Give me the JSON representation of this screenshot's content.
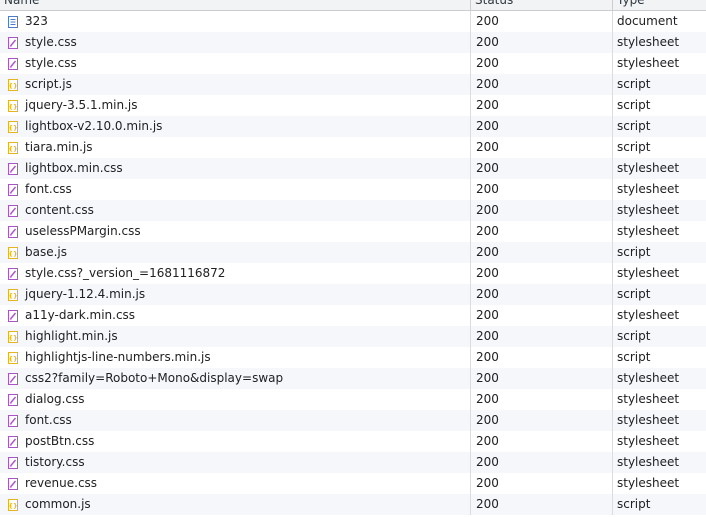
{
  "header": {
    "name_label": "Name",
    "status_label": "Status",
    "type_label": "Type"
  },
  "rows": [
    {
      "name": "323",
      "status": "200",
      "type": "document",
      "icon": "document-icon"
    },
    {
      "name": "style.css",
      "status": "200",
      "type": "stylesheet",
      "icon": "stylesheet-icon"
    },
    {
      "name": "style.css",
      "status": "200",
      "type": "stylesheet",
      "icon": "stylesheet-icon"
    },
    {
      "name": "script.js",
      "status": "200",
      "type": "script",
      "icon": "script-icon"
    },
    {
      "name": "jquery-3.5.1.min.js",
      "status": "200",
      "type": "script",
      "icon": "script-icon"
    },
    {
      "name": "lightbox-v2.10.0.min.js",
      "status": "200",
      "type": "script",
      "icon": "script-icon"
    },
    {
      "name": "tiara.min.js",
      "status": "200",
      "type": "script",
      "icon": "script-icon"
    },
    {
      "name": "lightbox.min.css",
      "status": "200",
      "type": "stylesheet",
      "icon": "stylesheet-icon"
    },
    {
      "name": "font.css",
      "status": "200",
      "type": "stylesheet",
      "icon": "stylesheet-icon"
    },
    {
      "name": "content.css",
      "status": "200",
      "type": "stylesheet",
      "icon": "stylesheet-icon"
    },
    {
      "name": "uselessPMargin.css",
      "status": "200",
      "type": "stylesheet",
      "icon": "stylesheet-icon"
    },
    {
      "name": "base.js",
      "status": "200",
      "type": "script",
      "icon": "script-icon"
    },
    {
      "name": "style.css?_version_=1681116872",
      "status": "200",
      "type": "stylesheet",
      "icon": "stylesheet-icon"
    },
    {
      "name": "jquery-1.12.4.min.js",
      "status": "200",
      "type": "script",
      "icon": "script-icon"
    },
    {
      "name": "a11y-dark.min.css",
      "status": "200",
      "type": "stylesheet",
      "icon": "stylesheet-icon"
    },
    {
      "name": "highlight.min.js",
      "status": "200",
      "type": "script",
      "icon": "script-icon"
    },
    {
      "name": "highlightjs-line-numbers.min.js",
      "status": "200",
      "type": "script",
      "icon": "script-icon"
    },
    {
      "name": "css2?family=Roboto+Mono&display=swap",
      "status": "200",
      "type": "stylesheet",
      "icon": "stylesheet-icon"
    },
    {
      "name": "dialog.css",
      "status": "200",
      "type": "stylesheet",
      "icon": "stylesheet-icon"
    },
    {
      "name": "font.css",
      "status": "200",
      "type": "stylesheet",
      "icon": "stylesheet-icon"
    },
    {
      "name": "postBtn.css",
      "status": "200",
      "type": "stylesheet",
      "icon": "stylesheet-icon"
    },
    {
      "name": "tistory.css",
      "status": "200",
      "type": "stylesheet",
      "icon": "stylesheet-icon"
    },
    {
      "name": "revenue.css",
      "status": "200",
      "type": "stylesheet",
      "icon": "stylesheet-icon"
    },
    {
      "name": "common.js",
      "status": "200",
      "type": "script",
      "icon": "script-icon"
    }
  ],
  "colors": {
    "document": "#4a7cc9",
    "stylesheet": "#a855c7",
    "script": "#e6b422"
  }
}
